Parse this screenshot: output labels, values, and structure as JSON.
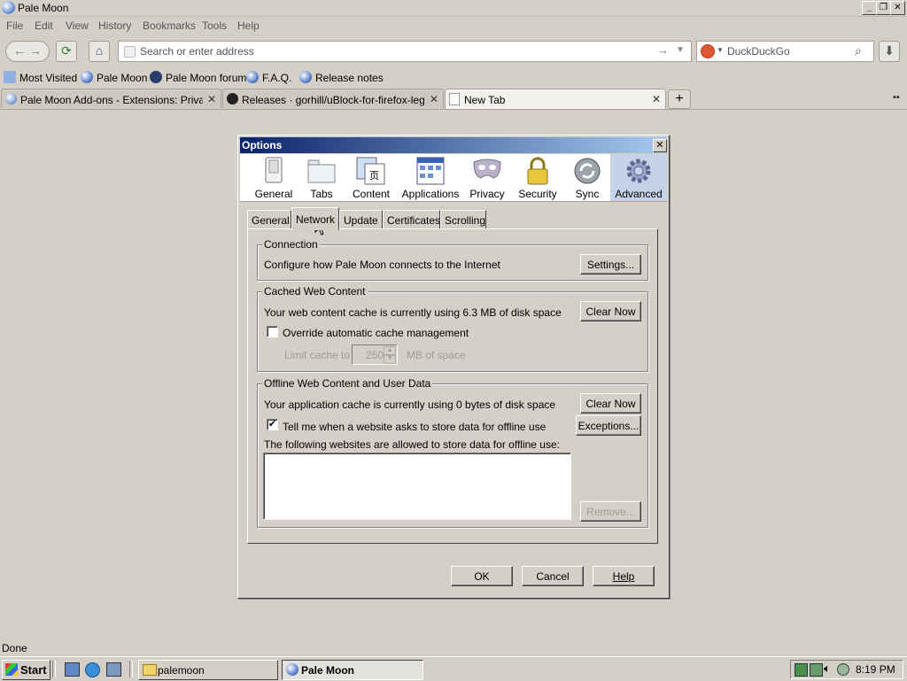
{
  "window": {
    "title": "Pale Moon"
  },
  "menu": [
    "File",
    "Edit",
    "View",
    "History",
    "Bookmarks",
    "Tools",
    "Help"
  ],
  "navbar": {
    "address_placeholder": "Search or enter address",
    "search_engine": "DuckDuckGo"
  },
  "bookmarks": [
    "Most Visited",
    "Pale Moon",
    "Pale Moon forum",
    "F.A.Q.",
    "Release notes"
  ],
  "tabs": [
    {
      "label": "Pale Moon Add-ons - Extensions: Privacy..."
    },
    {
      "label": "Releases · gorhill/uBlock-for-firefox-legac..."
    },
    {
      "label": "New Tab"
    }
  ],
  "dialog": {
    "title": "Options",
    "panes": [
      "General",
      "Tabs",
      "Content",
      "Applications",
      "Privacy",
      "Security",
      "Sync",
      "Advanced"
    ],
    "subtabs": [
      "General",
      "Network",
      "Update",
      "Certificates",
      "Scrolling"
    ],
    "connection": {
      "legend": "Connection",
      "text": "Configure how Pale Moon connects to the Internet",
      "button": "Settings..."
    },
    "cache": {
      "legend": "Cached Web Content",
      "text": "Your web content cache is currently using 6.3 MB of disk space",
      "button": "Clear Now",
      "override_label": "Override automatic cache management",
      "limit_label": "Limit cache to",
      "limit_value": "250",
      "limit_unit": "MB of space"
    },
    "offline": {
      "legend": "Offline Web Content and User Data",
      "text": "Your application cache is currently using 0 bytes of disk space",
      "clear_button": "Clear Now",
      "tell_label": "Tell me when a website asks to store data for offline use",
      "tell_checked": "✔",
      "exceptions_button": "Exceptions...",
      "list_label": "The following websites are allowed to store data for offline use:",
      "remove_button": "Remove..."
    },
    "buttons": {
      "ok": "OK",
      "cancel": "Cancel",
      "help": "Help"
    }
  },
  "status": "Done",
  "taskbar": {
    "start": "Start",
    "items": [
      "palemoon",
      "Pale Moon"
    ],
    "clock": "8:19 PM"
  }
}
